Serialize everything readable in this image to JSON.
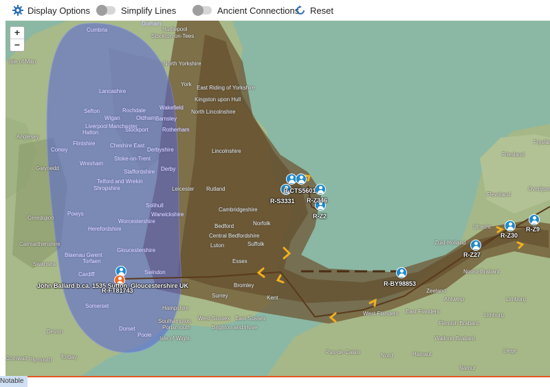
{
  "toolbar": {
    "display_options": "Display Options",
    "simplify_lines": "Simplify Lines",
    "ancient_connections": "Ancient Connections",
    "reset": "Reset"
  },
  "zoom": {
    "in": "+",
    "out": "−"
  },
  "map_labels": {
    "durham": "Durham",
    "hartlepool": "Hartlepool",
    "cumbria": "Cumbria",
    "stockton": "Stockton-on-Tees",
    "isle_of_man": "Isle of Man",
    "north_yorkshire": "North Yorkshire",
    "lancashire": "Lancashire",
    "york": "York",
    "east_riding": "East Riding of Yorkshire",
    "kingston": "Kingston upon Hull",
    "sefton": "Sefton",
    "rochdale": "Rochdale",
    "wakefield": "Wakefield",
    "wigan": "Wigan",
    "oldham": "Oldham",
    "barnsley": "Barnsley",
    "north_lincs": "North Lincolnshire",
    "liverpool": "Liverpool",
    "halton": "Halton",
    "manchester": "Manchester",
    "stockport": "Stockport",
    "rotherham": "Rotherham",
    "anglesey": "Anglesey",
    "flintshire": "Flintshire",
    "conwy": "Conwy",
    "cheshire_east": "Cheshire East",
    "derbyshire": "Derbyshire",
    "lincolnshire": "Lincolnshire",
    "gwynedd": "Gwynedd",
    "wrexham": "Wrexham",
    "stoke": "Stoke-on-Trent",
    "staffordshire": "Staffordshire",
    "derby": "Derby",
    "telford": "Telford and Wrekin",
    "shropshire": "Shropshire",
    "leicester": "Leicester",
    "ceredigion": "Ceredigion",
    "powys": "Powys",
    "solihull": "Solihull",
    "warwickshire": "Warwickshire",
    "herefordshire": "Herefordshire",
    "worcestershire": "Worcestershire",
    "carmarthenshire": "Carmarthenshire",
    "gloucestershire": "Gloucestershire",
    "swansea": "Swansea",
    "blaenau": "Blaenau Gwent",
    "torfaen": "Torfaen",
    "cardiff": "Cardiff",
    "swindon": "Swindon",
    "somerset": "Somerset",
    "dorset": "Dorset",
    "poole": "Poole",
    "devon": "Devon",
    "torbay": "Torbay",
    "plymouth": "Plymouth",
    "cornwall": "Cornwall",
    "hampshire": "Hampshire",
    "southampton": "Southampton",
    "portsmouth": "Portsmouth",
    "isle_of_wight": "Isle of Wight",
    "west_sussex": "West Sussex",
    "east_sussex": "East Sussex",
    "brighton": "Brighton and Hove",
    "surrey": "Surrey",
    "kent": "Kent",
    "bromley": "Bromley",
    "cambridgeshire": "Cambridgeshire",
    "suffolk": "Suffolk",
    "essex": "Essex",
    "norfolk": "Norfolk",
    "rutland": "Rutland",
    "bedford": "Bedford",
    "luton": "Luton",
    "central_beds": "Central Bedfordshire",
    "zeeland": "Zeeland",
    "zuid_holland": "Zuid-Holland",
    "utrecht": "Utrecht",
    "noord_brabant": "Noord-Brabant",
    "antwerp": "Antwerp",
    "limburg": "Limburg",
    "west_flanders": "West Flanders",
    "east_flanders": "East Flanders",
    "flemish_brabant": "Flemish Brabant",
    "walloon_brabant": "Walloon Brabant",
    "pas_de_calais": "Pas-de-Calais",
    "nord": "Nord",
    "hainaut": "Hainaut",
    "liege": "Liege",
    "namur": "Namur",
    "friesland": "Friesland",
    "flevoland": "Flevoland",
    "fryslan": "Fryslân",
    "overijssel": "Overijssel"
  },
  "haplogroups": {
    "cts5601": "R-CTS5601",
    "s3331": "R-S3331",
    "z346": "R-Z346",
    "z2": "R-Z2",
    "by98853": "R-BY98853",
    "z30": "R-Z30",
    "z9": "R-Z9",
    "z27": "R-Z27",
    "ft81743": "R-FT81743"
  },
  "ancestor_label": "John Ballard b.ca. 1535 Sutton, Gloucestershire UK",
  "footer": {
    "notable": "Notable"
  },
  "colors": {
    "sea": "#8bb8a4",
    "land": "#a8b98a",
    "migration_band": "#6e5330",
    "zone_overlay": "#5865d8",
    "pin_blue": "#1f8acb",
    "pin_orange": "#f06a22",
    "arrow": "#f2b01e",
    "footer_line": "#e2571e"
  }
}
